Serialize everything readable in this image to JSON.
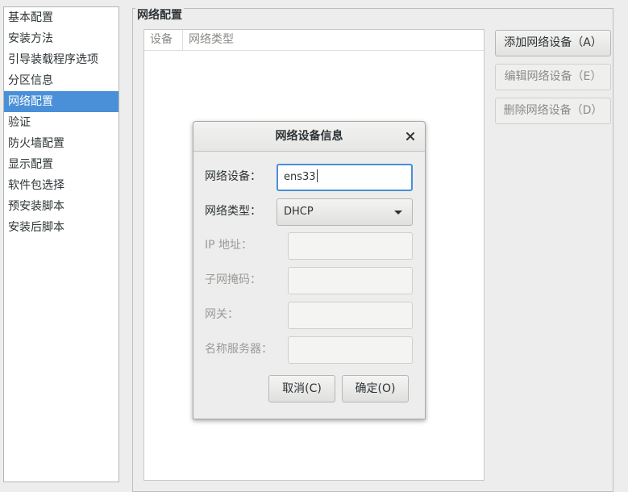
{
  "sidebar": {
    "items": [
      {
        "label": "基本配置",
        "selected": false
      },
      {
        "label": "安装方法",
        "selected": false
      },
      {
        "label": "引导装载程序选项",
        "selected": false
      },
      {
        "label": "分区信息",
        "selected": false
      },
      {
        "label": "网络配置",
        "selected": true
      },
      {
        "label": "验证",
        "selected": false
      },
      {
        "label": "防火墙配置",
        "selected": false
      },
      {
        "label": "显示配置",
        "selected": false
      },
      {
        "label": "软件包选择",
        "selected": false
      },
      {
        "label": "预安装脚本",
        "selected": false
      },
      {
        "label": "安装后脚本",
        "selected": false
      }
    ]
  },
  "main": {
    "group_title": "网络配置",
    "table": {
      "columns": [
        "设备",
        "网络类型"
      ],
      "rows": []
    },
    "buttons": {
      "add": "添加网络设备（A）",
      "edit": "编辑网络设备（E）",
      "delete": "删除网络设备（D）"
    }
  },
  "dialog": {
    "title": "网络设备信息",
    "close_icon": "close-icon",
    "fields": {
      "device_label": "网络设备：",
      "device_value": "ens33",
      "type_label": "网络类型：",
      "type_value": "DHCP",
      "ip_label": "IP 地址：",
      "netmask_label": "子网掩码：",
      "gateway_label": "网关：",
      "nameserver_label": "名称服务器："
    },
    "cancel_label": "取消(C)",
    "ok_label": "确定(O)"
  },
  "colors": {
    "selection": "#4a90d9",
    "focus_border": "#4a90d9",
    "window_bg": "#ededed"
  }
}
